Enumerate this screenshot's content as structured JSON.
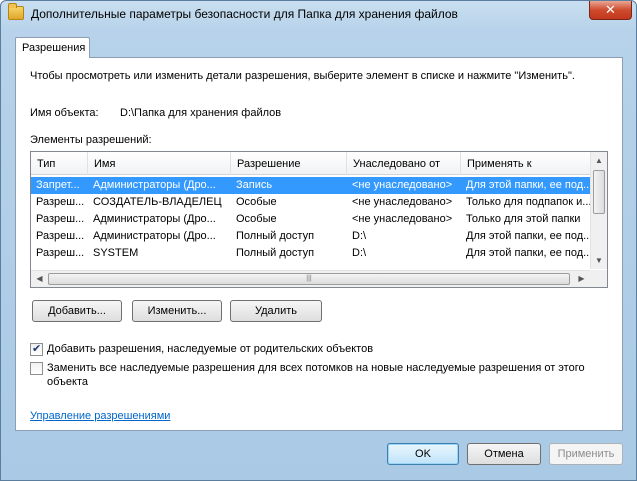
{
  "window": {
    "title": "Дополнительные параметры безопасности для Папка для хранения файлов",
    "close_glyph": "✕"
  },
  "tab": {
    "label": "Разрешения"
  },
  "intro_text": "Чтобы просмотреть или изменить детали разрешения, выберите элемент в списке и нажмите \"Изменить\".",
  "object": {
    "label": "Имя объекта:",
    "value": "D:\\Папка для хранения файлов"
  },
  "entries_label": "Элементы разрешений:",
  "table": {
    "columns": [
      "Тип",
      "Имя",
      "Разрешение",
      "Унаследовано от",
      "Применять к"
    ],
    "rows": [
      [
        "Запрет...",
        "Администраторы (Дро...",
        "Запись",
        "<не унаследовано>",
        "Для этой папки, ее под..."
      ],
      [
        "Разреш...",
        "СОЗДАТЕЛЬ-ВЛАДЕЛЕЦ",
        "Особые",
        "<не унаследовано>",
        "Только для подпапок и..."
      ],
      [
        "Разреш...",
        "Администраторы (Дро...",
        "Особые",
        "<не унаследовано>",
        "Только для этой папки"
      ],
      [
        "Разреш...",
        "Администраторы (Дро...",
        "Полный доступ",
        "D:\\",
        "Для этой папки, ее под..."
      ],
      [
        "Разреш...",
        "SYSTEM",
        "Полный доступ",
        "D:\\",
        "Для этой папки, ее под..."
      ]
    ],
    "selected_row": 0
  },
  "buttons": {
    "add": "Добавить...",
    "edit": "Изменить...",
    "delete": "Удалить",
    "ok": "OK",
    "cancel": "Отмена",
    "apply": "Применить"
  },
  "options": {
    "inherit_label": "Добавить разрешения, наследуемые от родительских объектов",
    "inherit_checked": true,
    "replace_label_line1": "Заменить все наследуемые разрешения для всех потомков на новые наследуемые разрешения от этого",
    "replace_label_line2": "объекта",
    "replace_checked": false
  },
  "manage_link": "Управление разрешениями",
  "icons": {
    "window_icon": "folder-icon",
    "scroll_up": "▲",
    "scroll_down": "▼",
    "scroll_left": "◀",
    "scroll_right": "▶",
    "thumb_grip": "|||"
  }
}
